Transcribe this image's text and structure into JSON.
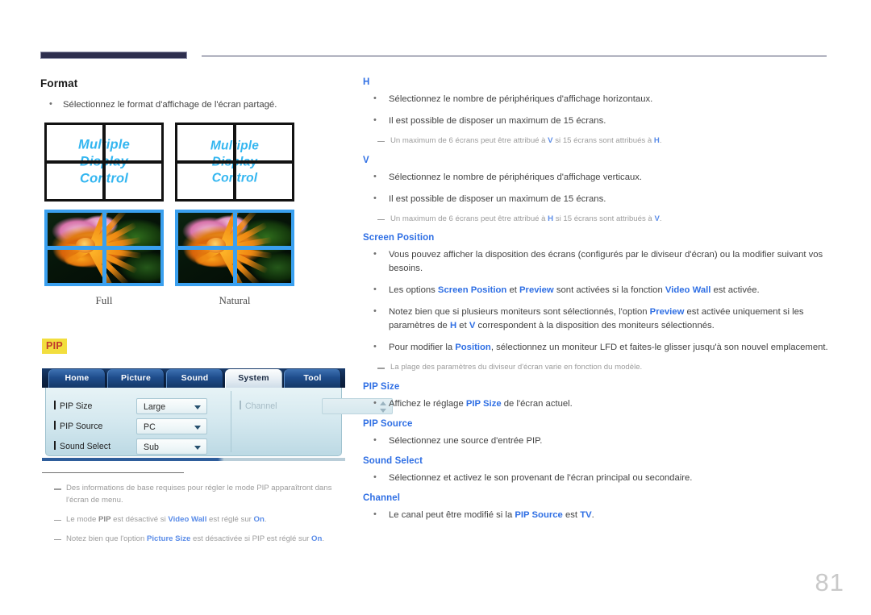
{
  "page": {
    "number": "81"
  },
  "theme": {
    "accent_blue": "#2f6fe4",
    "rule_navy": "#2e2f4f",
    "badge_yellow": "#f2de3e",
    "badge_text_red": "#c0392b",
    "osd_screen_text_blue": "#34b6f0",
    "figure_border_blue": "#3aa0ef"
  },
  "left_column": {
    "format": {
      "title": "Format",
      "bullets": [
        "Sélectionnez le format d'affichage de l'écran partagé."
      ],
      "figures": [
        {
          "caption": "Full",
          "screen_text": [
            "Multiple",
            "Display",
            "Control"
          ]
        },
        {
          "caption": "Natural",
          "screen_text": [
            "Multiple",
            "Display",
            "Control"
          ]
        }
      ]
    },
    "pip": {
      "badge": "PIP",
      "osd": {
        "tabs": [
          {
            "label": "Home",
            "active": false
          },
          {
            "label": "Picture",
            "active": false
          },
          {
            "label": "Sound",
            "active": false
          },
          {
            "label": "System",
            "active": true
          },
          {
            "label": "Tool",
            "active": false
          }
        ],
        "rows_left": [
          {
            "label": "PIP Size",
            "value": "Large",
            "control": "dropdown",
            "enabled": true
          },
          {
            "label": "PIP Source",
            "value": "PC",
            "control": "dropdown",
            "enabled": true
          },
          {
            "label": "Sound Select",
            "value": "Sub",
            "control": "dropdown",
            "enabled": true
          }
        ],
        "rows_right": [
          {
            "label": "Channel",
            "value": "",
            "control": "spinner",
            "enabled": false
          }
        ]
      },
      "notes": [
        {
          "parts": [
            {
              "t": "Des informations de base requises pour régler le mode PIP apparaîtront dans l'écran de menu.",
              "s": "plain"
            }
          ]
        },
        {
          "parts": [
            {
              "t": "Le mode ",
              "s": "plain"
            },
            {
              "t": "PIP",
              "s": "dk"
            },
            {
              "t": " est désactivé si ",
              "s": "plain"
            },
            {
              "t": "Video Wall",
              "s": "hl"
            },
            {
              "t": " est réglé sur ",
              "s": "plain"
            },
            {
              "t": "On",
              "s": "hl"
            },
            {
              "t": ".",
              "s": "plain"
            }
          ]
        },
        {
          "parts": [
            {
              "t": "Notez bien que l'option ",
              "s": "plain"
            },
            {
              "t": "Picture Size",
              "s": "hl"
            },
            {
              "t": " est désactivée si PIP est réglé sur ",
              "s": "plain"
            },
            {
              "t": "On",
              "s": "hl"
            },
            {
              "t": ".",
              "s": "plain"
            }
          ]
        }
      ]
    }
  },
  "right_column": {
    "sections": [
      {
        "title": "H",
        "bullets": [
          {
            "parts": [
              {
                "t": "Sélectionnez le nombre de périphériques d'affichage horizontaux.",
                "s": "plain"
              }
            ]
          },
          {
            "parts": [
              {
                "t": "Il est possible de disposer un maximum de 15 écrans.",
                "s": "plain"
              }
            ],
            "note": {
              "parts": [
                {
                  "t": "Un maximum de 6 écrans peut être attribué à ",
                  "s": "plain"
                },
                {
                  "t": "V",
                  "s": "hl"
                },
                {
                  "t": " si 15 écrans sont attribués à ",
                  "s": "plain"
                },
                {
                  "t": "H",
                  "s": "hl"
                },
                {
                  "t": ".",
                  "s": "plain"
                }
              ]
            }
          }
        ]
      },
      {
        "title": "V",
        "bullets": [
          {
            "parts": [
              {
                "t": "Sélectionnez le nombre de périphériques d'affichage verticaux.",
                "s": "plain"
              }
            ]
          },
          {
            "parts": [
              {
                "t": "Il est possible de disposer un maximum de 15 écrans.",
                "s": "plain"
              }
            ],
            "note": {
              "parts": [
                {
                  "t": "Un maximum de 6 écrans peut être attribué à ",
                  "s": "plain"
                },
                {
                  "t": "H",
                  "s": "hl"
                },
                {
                  "t": " si 15 écrans sont attribués à ",
                  "s": "plain"
                },
                {
                  "t": "V",
                  "s": "hl"
                },
                {
                  "t": ".",
                  "s": "plain"
                }
              ]
            }
          }
        ]
      },
      {
        "title": "Screen Position",
        "bullets": [
          {
            "parts": [
              {
                "t": "Vous pouvez afficher la disposition des écrans (configurés par le diviseur d'écran) ou la modifier suivant vos besoins.",
                "s": "plain"
              }
            ]
          },
          {
            "parts": [
              {
                "t": "Les options ",
                "s": "plain"
              },
              {
                "t": "Screen Position",
                "s": "hl"
              },
              {
                "t": " et ",
                "s": "plain"
              },
              {
                "t": "Preview",
                "s": "hl"
              },
              {
                "t": " sont activées si la fonction ",
                "s": "plain"
              },
              {
                "t": "Video Wall",
                "s": "hl"
              },
              {
                "t": " est activée.",
                "s": "plain"
              }
            ]
          },
          {
            "parts": [
              {
                "t": "Notez bien que si plusieurs moniteurs sont sélectionnés, l'option ",
                "s": "plain"
              },
              {
                "t": "Preview",
                "s": "hl"
              },
              {
                "t": " est activée uniquement si les paramètres de ",
                "s": "plain"
              },
              {
                "t": "H",
                "s": "hl"
              },
              {
                "t": " et ",
                "s": "plain"
              },
              {
                "t": "V",
                "s": "hl"
              },
              {
                "t": " correspondent à la disposition des moniteurs sélectionnés.",
                "s": "plain"
              }
            ]
          },
          {
            "parts": [
              {
                "t": "Pour modifier la ",
                "s": "plain"
              },
              {
                "t": "Position",
                "s": "hl"
              },
              {
                "t": ", sélectionnez un moniteur LFD et faites-le glisser jusqu'à son nouvel emplacement.",
                "s": "plain"
              }
            ],
            "note": {
              "parts": [
                {
                  "t": "La plage des paramètres du diviseur d'écran varie en fonction du modèle.",
                  "s": "plain"
                }
              ]
            }
          }
        ]
      },
      {
        "title": "PIP Size",
        "bullets": [
          {
            "parts": [
              {
                "t": "Affichez le réglage ",
                "s": "plain"
              },
              {
                "t": "PIP Size",
                "s": "hl"
              },
              {
                "t": " de l'écran actuel.",
                "s": "plain"
              }
            ]
          }
        ]
      },
      {
        "title": "PIP Source",
        "bullets": [
          {
            "parts": [
              {
                "t": "Sélectionnez une source d'entrée PIP.",
                "s": "plain"
              }
            ]
          }
        ]
      },
      {
        "title": "Sound Select",
        "bullets": [
          {
            "parts": [
              {
                "t": "Sélectionnez et activez le son provenant de l'écran principal ou secondaire.",
                "s": "plain"
              }
            ]
          }
        ]
      },
      {
        "title": "Channel",
        "bullets": [
          {
            "parts": [
              {
                "t": "Le canal peut être modifié si la ",
                "s": "plain"
              },
              {
                "t": "PIP Source",
                "s": "hl"
              },
              {
                "t": " est ",
                "s": "plain"
              },
              {
                "t": "TV",
                "s": "hl"
              },
              {
                "t": ".",
                "s": "plain"
              }
            ]
          }
        ]
      }
    ]
  }
}
